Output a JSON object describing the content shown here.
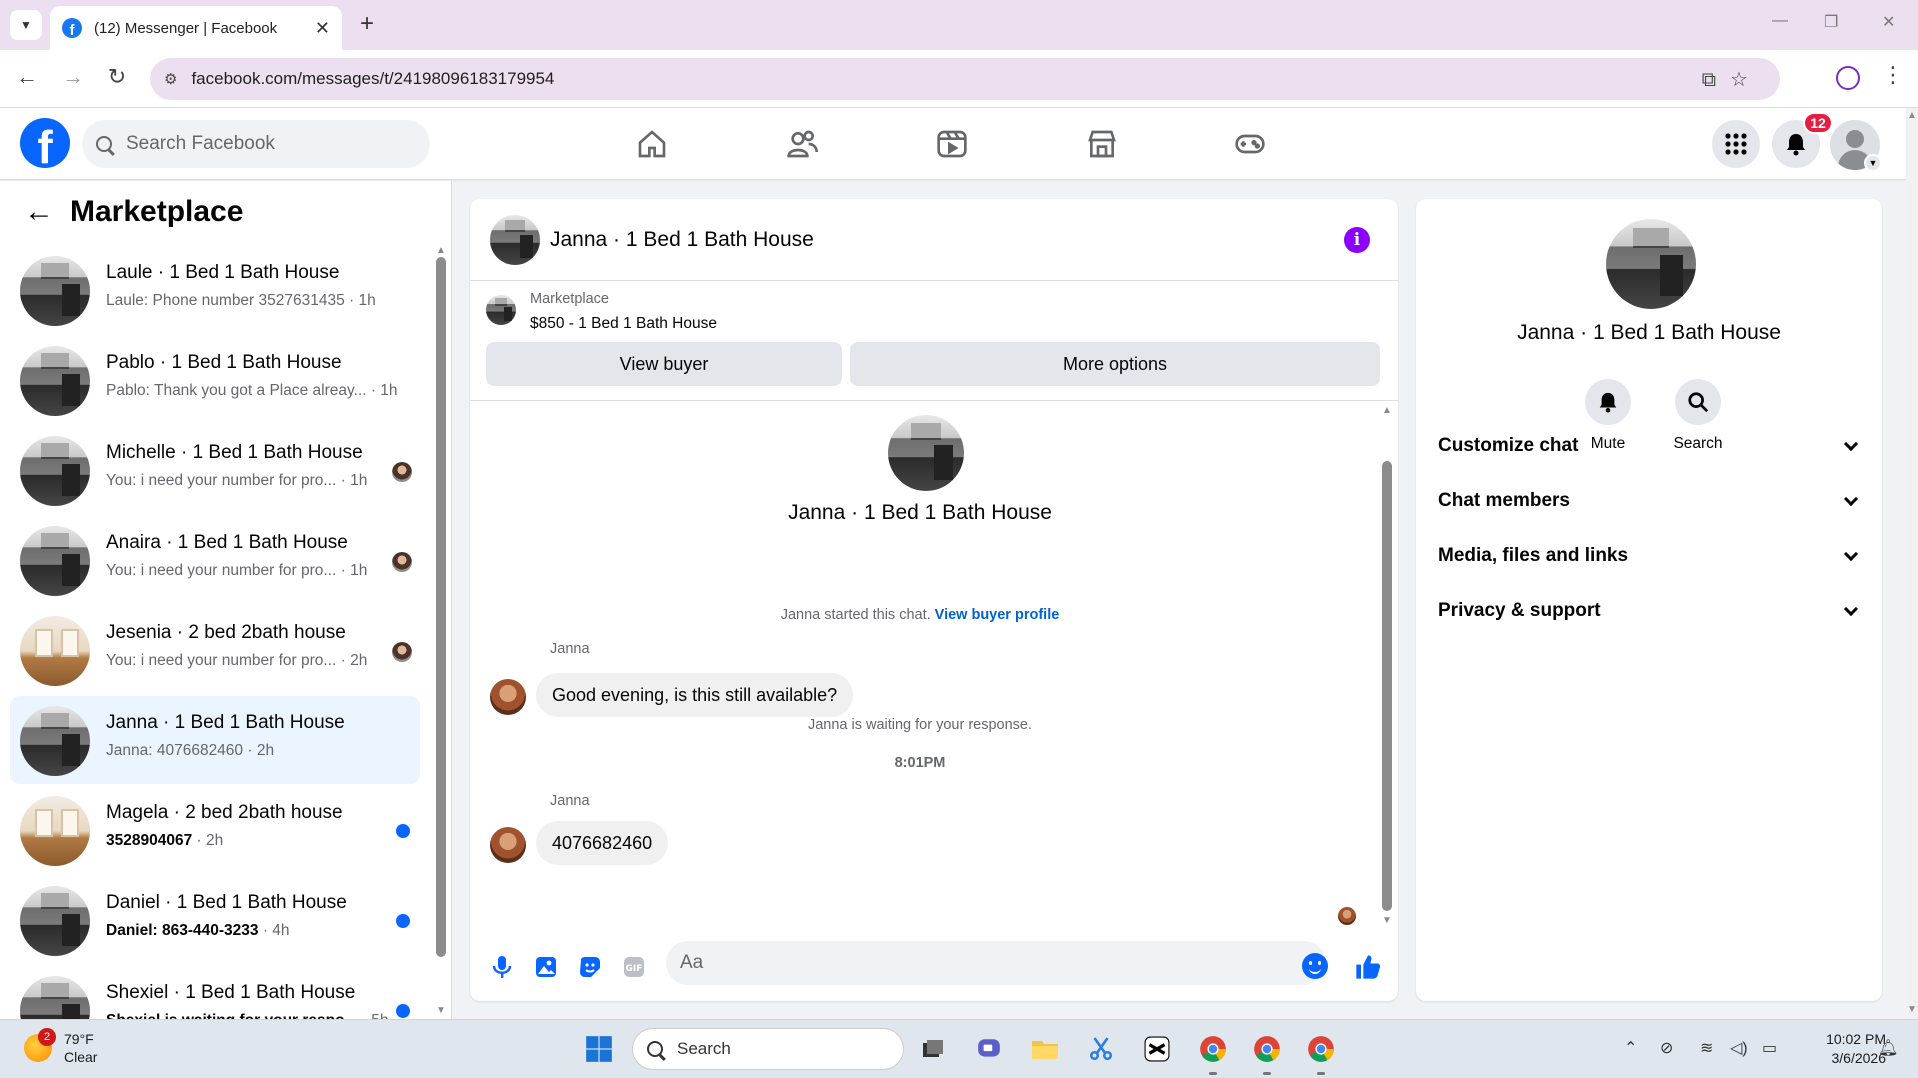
{
  "browser": {
    "tab_title": "(12) Messenger | Facebook",
    "url": "facebook.com/messages/t/24198096183179954"
  },
  "header": {
    "search_placeholder": "Search Facebook",
    "notification_count": "12",
    "nav_icons": [
      "home-icon",
      "friends-icon",
      "video-icon",
      "marketplace-icon",
      "gaming-icon"
    ]
  },
  "sidebar": {
    "title": "Marketplace",
    "chats": [
      {
        "name": "Laule · 1 Bed 1 Bath House",
        "preview": "Laule: Phone number 3527631435",
        "time": "1h",
        "thumb": "kitchen",
        "unread": false,
        "seen": false
      },
      {
        "name": "Pablo · 1 Bed 1 Bath House",
        "preview": "Pablo: Thank you got a Place alreay...",
        "time": "1h",
        "thumb": "kitchen",
        "unread": false,
        "seen": false
      },
      {
        "name": "Michelle · 1 Bed 1 Bath House",
        "preview": "You: i need your number for pro...",
        "time": "1h",
        "thumb": "kitchen",
        "unread": false,
        "seen": true
      },
      {
        "name": "Anaira · 1 Bed 1 Bath House",
        "preview": "You: i need your number for pro...",
        "time": "1h",
        "thumb": "kitchen",
        "unread": false,
        "seen": true
      },
      {
        "name": "Jesenia · 2 bed 2bath house",
        "preview": "You: i need your number for pro...",
        "time": "2h",
        "thumb": "wood",
        "unread": false,
        "seen": true
      },
      {
        "name": "Janna · 1 Bed 1 Bath House",
        "preview": "Janna: 4076682460",
        "time": "2h",
        "thumb": "kitchen",
        "unread": false,
        "seen": false,
        "active": true
      },
      {
        "name": "Magela · 2 bed 2bath house",
        "preview": "3528904067",
        "time": "2h",
        "thumb": "wood",
        "unread": true,
        "seen": false
      },
      {
        "name": "Daniel · 1 Bed 1 Bath House",
        "preview": "Daniel: 863-440-3233",
        "time": "4h",
        "thumb": "kitchen",
        "unread": true,
        "seen": false
      },
      {
        "name": "Shexiel · 1 Bed 1 Bath House",
        "preview": "Shexiel is waiting for your respo...",
        "time": "5h",
        "thumb": "kitchen",
        "unread": true,
        "seen": false
      }
    ]
  },
  "conversation": {
    "title": "Janna · 1 Bed 1 Bath House",
    "listing_source": "Marketplace",
    "listing_price": "$850 - 1 Bed 1 Bath House",
    "view_buyer_label": "View buyer",
    "more_options_label": "More options",
    "intro_name": "Janna · 1 Bed 1 Bath House",
    "started_text": "Janna started this chat.",
    "view_buyer_profile": "View buyer profile",
    "messages": [
      {
        "sender": "Janna",
        "text": "Good evening, is this still available?"
      },
      {
        "sender": "Janna",
        "text": "4076682460"
      }
    ],
    "waiting_text": "Janna is waiting for your response.",
    "timestamp": "8:01PM",
    "composer_placeholder": "Aa"
  },
  "info_panel": {
    "name": "Janna · 1 Bed 1 Bath House",
    "mute_label": "Mute",
    "search_label": "Search",
    "sections": [
      "Customize chat",
      "Chat members",
      "Media, files and links",
      "Privacy & support"
    ]
  },
  "taskbar": {
    "weather_badge": "2",
    "temperature": "79°F",
    "condition": "Clear",
    "search_placeholder": "Search",
    "time": "10:02 PM",
    "date": "3/6/2026"
  },
  "colors": {
    "fb_blue": "#0866ff",
    "badge_red": "#e41e3f",
    "info_purple": "#8b00ff",
    "active_chat_bg": "#ebf5ff"
  }
}
